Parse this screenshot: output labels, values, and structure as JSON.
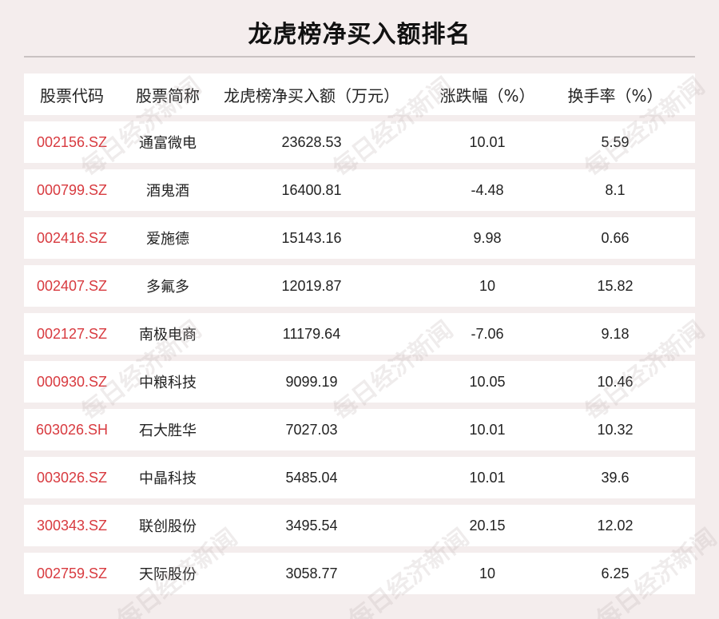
{
  "title": "龙虎榜净买入额排名",
  "headers": [
    "股票代码",
    "股票简称",
    "龙虎榜净买入额（万元）",
    "涨跌幅（%）",
    "换手率（%）"
  ],
  "rows": [
    {
      "code": "002156.SZ",
      "name": "通富微电",
      "net_buy": "23628.53",
      "change": "10.01",
      "turnover": "5.59"
    },
    {
      "code": "000799.SZ",
      "name": "酒鬼酒",
      "net_buy": "16400.81",
      "change": "-4.48",
      "turnover": "8.1"
    },
    {
      "code": "002416.SZ",
      "name": "爱施德",
      "net_buy": "15143.16",
      "change": "9.98",
      "turnover": "0.66"
    },
    {
      "code": "002407.SZ",
      "name": "多氟多",
      "net_buy": "12019.87",
      "change": "10",
      "turnover": "15.82"
    },
    {
      "code": "002127.SZ",
      "name": "南极电商",
      "net_buy": "11179.64",
      "change": "-7.06",
      "turnover": "9.18"
    },
    {
      "code": "000930.SZ",
      "name": "中粮科技",
      "net_buy": "9099.19",
      "change": "10.05",
      "turnover": "10.46"
    },
    {
      "code": "603026.SH",
      "name": "石大胜华",
      "net_buy": "7027.03",
      "change": "10.01",
      "turnover": "10.32"
    },
    {
      "code": "003026.SZ",
      "name": "中晶科技",
      "net_buy": "5485.04",
      "change": "10.01",
      "turnover": "39.6"
    },
    {
      "code": "300343.SZ",
      "name": "联创股份",
      "net_buy": "3495.54",
      "change": "20.15",
      "turnover": "12.02"
    },
    {
      "code": "002759.SZ",
      "name": "天际股份",
      "net_buy": "3058.77",
      "change": "10",
      "turnover": "6.25"
    }
  ],
  "watermark": "每日经济新闻",
  "colors": {
    "code": "#d83a3f",
    "background": "#f4eded",
    "row": "#ffffff"
  }
}
